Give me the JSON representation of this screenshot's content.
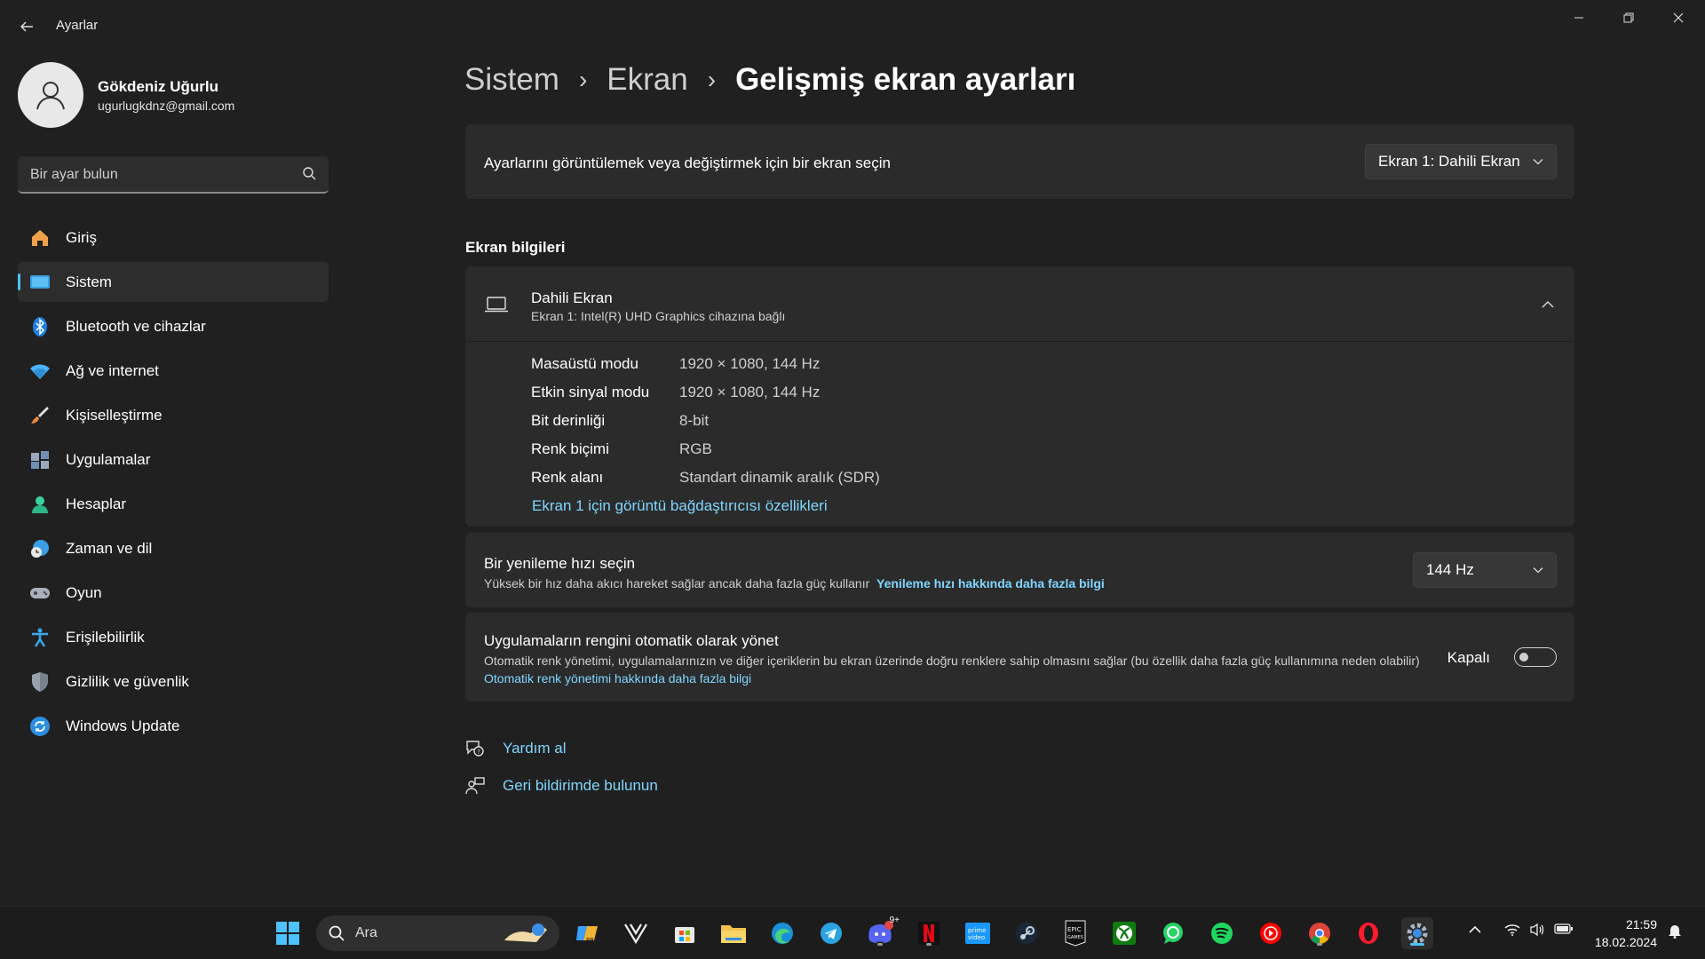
{
  "app": {
    "title": "Ayarlar",
    "back_icon": "back-arrow-icon",
    "minimize_icon": "minimize-icon",
    "restore_icon": "restore-icon",
    "close_icon": "close-icon"
  },
  "user": {
    "name": "Gökdeniz Uğurlu",
    "email": "ugurlugkdnz@gmail.com",
    "avatar_icon": "person-icon"
  },
  "search": {
    "placeholder": "Bir ayar bulun",
    "icon": "search-icon"
  },
  "sidebar": {
    "items": [
      {
        "label": "Giriş",
        "icon": "home-icon",
        "active": false
      },
      {
        "label": "Sistem",
        "icon": "system-display-icon",
        "active": true
      },
      {
        "label": "Bluetooth ve cihazlar",
        "icon": "bluetooth-icon",
        "active": false
      },
      {
        "label": "Ağ ve internet",
        "icon": "wifi-icon",
        "active": false
      },
      {
        "label": "Kişiselleştirme",
        "icon": "brush-icon",
        "active": false
      },
      {
        "label": "Uygulamalar",
        "icon": "apps-icon",
        "active": false
      },
      {
        "label": "Hesaplar",
        "icon": "account-icon",
        "active": false
      },
      {
        "label": "Zaman ve dil",
        "icon": "clock-globe-icon",
        "active": false
      },
      {
        "label": "Oyun",
        "icon": "gamepad-icon",
        "active": false
      },
      {
        "label": "Erişilebilirlik",
        "icon": "accessibility-icon",
        "active": false
      },
      {
        "label": "Gizlilik ve güvenlik",
        "icon": "shield-icon",
        "active": false
      },
      {
        "label": "Windows Update",
        "icon": "update-icon",
        "active": false
      }
    ]
  },
  "breadcrumb": {
    "items": [
      "Sistem",
      "Ekran",
      "Gelişmiş ekran ayarları"
    ],
    "separator": "›"
  },
  "display_select": {
    "label": "Ayarlarını görüntülemek veya değiştirmek için bir ekran seçin",
    "value": "Ekran 1: Dahili Ekran"
  },
  "display_info": {
    "section_title": "Ekran bilgileri",
    "title": "Dahili Ekran",
    "subtitle": "Ekran 1: Intel(R) UHD Graphics cihazına bağlı",
    "rows": [
      {
        "label": "Masaüstü modu",
        "value": "1920 × 1080, 144 Hz"
      },
      {
        "label": "Etkin sinyal modu",
        "value": "1920 × 1080, 144 Hz"
      },
      {
        "label": "Bit derinliği",
        "value": "8-bit"
      },
      {
        "label": "Renk biçimi",
        "value": "RGB"
      },
      {
        "label": "Renk alanı",
        "value": "Standart dinamik aralık (SDR)"
      }
    ],
    "adapter_link": "Ekran 1 için görüntü bağdaştırıcısı özellikleri",
    "expanded": true
  },
  "refresh_rate": {
    "title": "Bir yenileme hızı seçin",
    "description": "Yüksek bir hız daha akıcı hareket sağlar ancak daha fazla güç kullanır",
    "link": "Yenileme hızı hakkında daha fazla bilgi",
    "value": "144 Hz"
  },
  "color_management": {
    "title": "Uygulamaların rengini otomatik olarak yönet",
    "description": "Otomatik renk yönetimi, uygulamalarınızın ve diğer içeriklerin bu ekran üzerinde doğru renklere sahip olmasını sağlar (bu özellik daha fazla güç kullanımına neden olabilir)",
    "link": "Otomatik renk yönetimi hakkında daha fazla bilgi",
    "toggle_label": "Kapalı",
    "enabled": false
  },
  "help": {
    "get_help": "Yardım al",
    "feedback": "Geri bildirimde bulunun"
  },
  "taskbar": {
    "search_label": "Ara",
    "apps": [
      {
        "name": "start",
        "icon": "windows-start-icon"
      },
      {
        "name": "copilot",
        "icon": "copilot-icon"
      },
      {
        "name": "vivaldi",
        "icon": "vivaldi-icon"
      },
      {
        "name": "store",
        "icon": "store-icon"
      },
      {
        "name": "explorer",
        "icon": "folder-icon"
      },
      {
        "name": "edge",
        "icon": "edge-icon"
      },
      {
        "name": "telegram",
        "icon": "telegram-icon"
      },
      {
        "name": "discord",
        "icon": "discord-icon",
        "badge": "9+"
      },
      {
        "name": "netflix",
        "icon": "netflix-icon"
      },
      {
        "name": "prime-video",
        "icon": "prime-video-icon"
      },
      {
        "name": "steam",
        "icon": "steam-icon"
      },
      {
        "name": "epic-games",
        "icon": "epic-games-icon"
      },
      {
        "name": "xbox",
        "icon": "xbox-icon"
      },
      {
        "name": "whatsapp",
        "icon": "whatsapp-icon"
      },
      {
        "name": "spotify",
        "icon": "spotify-icon"
      },
      {
        "name": "youtube-music",
        "icon": "youtube-icon"
      },
      {
        "name": "chrome",
        "icon": "chrome-icon"
      },
      {
        "name": "opera",
        "icon": "opera-icon"
      },
      {
        "name": "settings",
        "icon": "settings-gear-icon"
      }
    ],
    "time": "21:59",
    "date": "18.02.2024"
  },
  "colors": {
    "accent": "#4cc2ff",
    "link": "#7fd6ff",
    "background": "#202020",
    "card": "#2b2b2b"
  }
}
